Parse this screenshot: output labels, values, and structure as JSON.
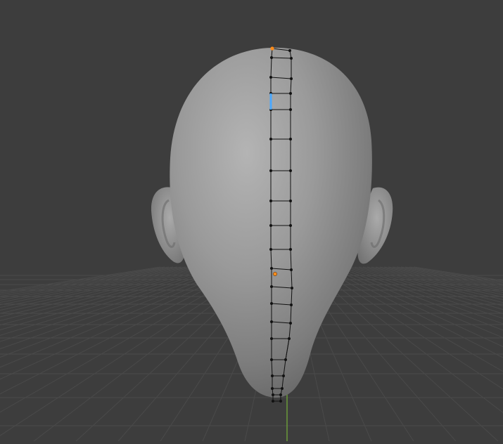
{
  "viewport": {
    "background_color": "#3d3d3d",
    "grid_color": "#4a4a4a",
    "y_axis_color": "#6a9a3a",
    "mesh_color": "#8f8f8f",
    "wire_color": "#111111",
    "selected_vertex_color": "#ff8c1a",
    "selected_edge_color": "#4aa8ff"
  }
}
